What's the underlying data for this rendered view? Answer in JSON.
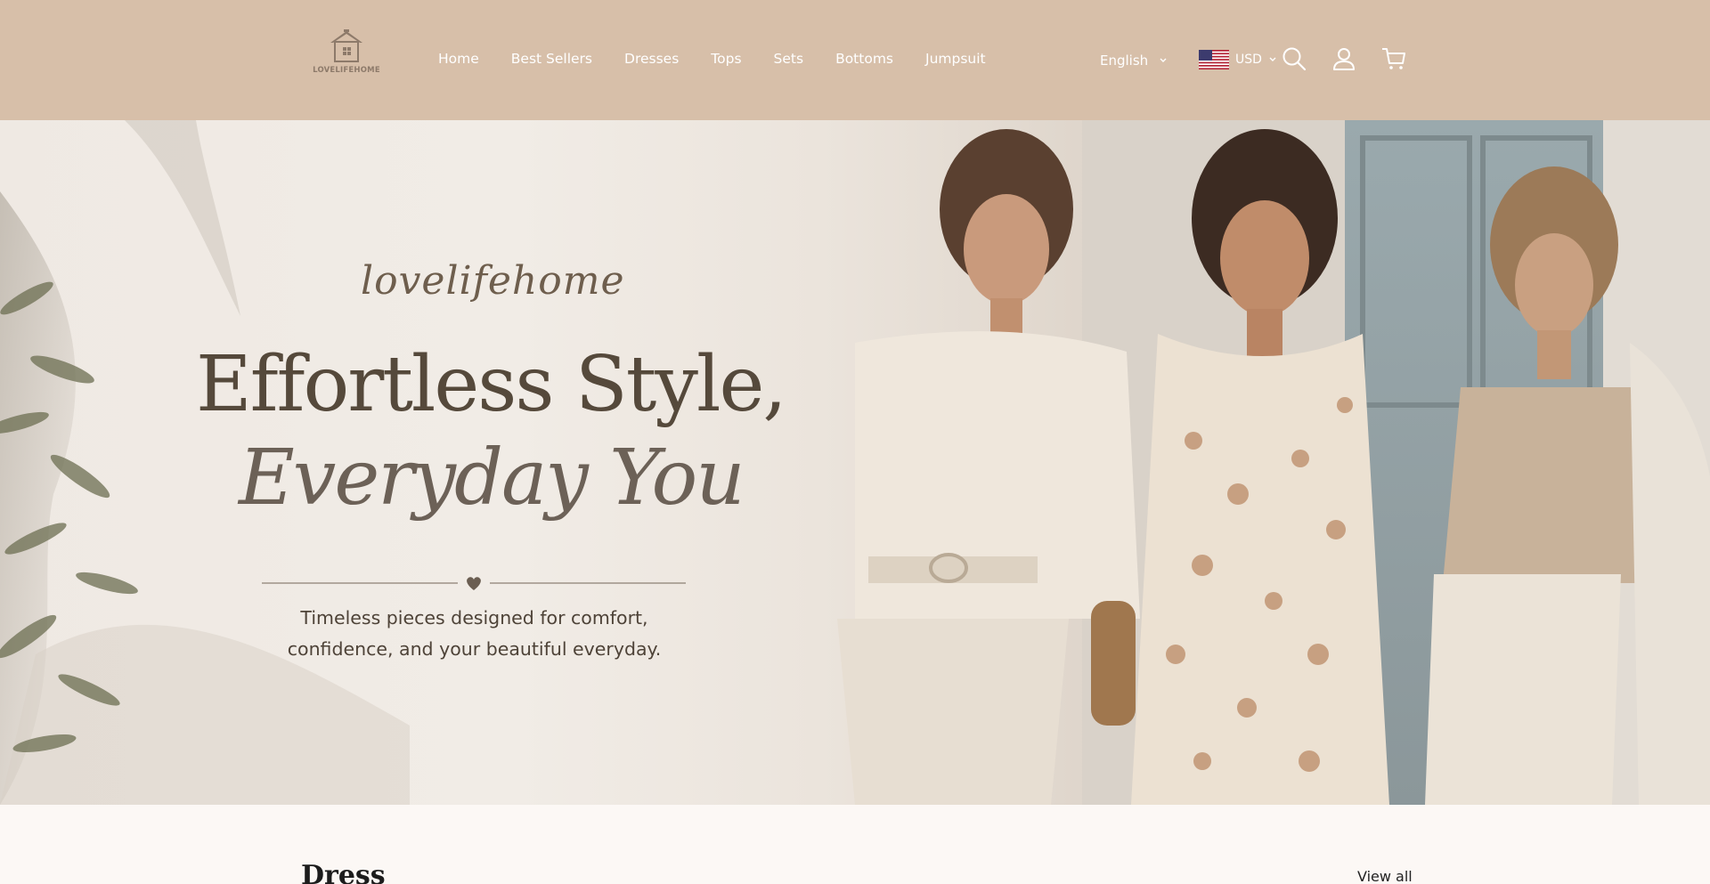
{
  "brand": {
    "logo_text": "LOVELIFEHOME",
    "accent": "#d7bfa9"
  },
  "nav": {
    "items": [
      {
        "label": "Home"
      },
      {
        "label": "Best Sellers"
      },
      {
        "label": "Dresses"
      },
      {
        "label": "Tops"
      },
      {
        "label": "Sets"
      },
      {
        "label": "Bottoms"
      },
      {
        "label": "Jumpsuit"
      }
    ]
  },
  "header": {
    "language": "English",
    "currency": "USD",
    "icons": [
      "search-icon",
      "account-icon",
      "cart-icon"
    ]
  },
  "hero": {
    "script_brand": "lovelifehome",
    "headline_line1": "Effortless Style,",
    "headline_line2": "Everyday You",
    "tagline_line1": "Timeless pieces designed for comfort,",
    "tagline_line2": "confidence, and your beautiful everyday."
  },
  "section": {
    "title": "Dress",
    "view_all": "View all"
  }
}
